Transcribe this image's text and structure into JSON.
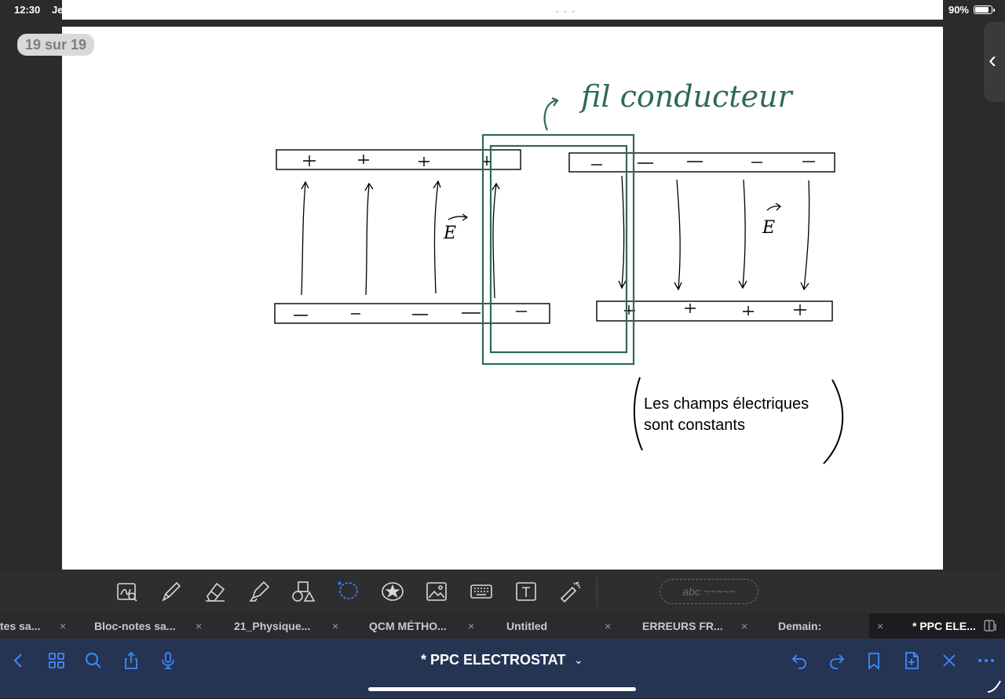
{
  "status_bar": {
    "time": "12:30",
    "date_fragment": "Je",
    "battery": "90%",
    "battery_level": 0.9
  },
  "page_counter": "19 sur 19",
  "canvas": {
    "annotation_fil": "fil conducteur",
    "field_label_left": "E",
    "field_label_right": "E",
    "note_line1": "Les champs électriques",
    "note_line2": "sont constants",
    "colors": {
      "ink": "#000000",
      "green_ink": "#2e6b4f"
    }
  },
  "toolbar": {
    "tools": [
      {
        "name": "zoom-pen-icon"
      },
      {
        "name": "pen-icon"
      },
      {
        "name": "eraser-icon"
      },
      {
        "name": "highlighter-icon"
      },
      {
        "name": "shapes-icon"
      },
      {
        "name": "lasso-icon",
        "active": true
      },
      {
        "name": "sticker-icon"
      },
      {
        "name": "image-icon"
      },
      {
        "name": "keyboard-icon"
      },
      {
        "name": "text-box-icon"
      },
      {
        "name": "laser-pointer-icon"
      }
    ],
    "handwriting_placeholder": "abc ~~~~~"
  },
  "tabs": [
    {
      "label": "tes sa...",
      "close": "×"
    },
    {
      "label": "Bloc-notes sa...",
      "close": "×"
    },
    {
      "label": "21_Physique...",
      "close": "×"
    },
    {
      "label": "QCM MÉTHO...",
      "close": "×"
    },
    {
      "label": "Untitled",
      "close": "×"
    },
    {
      "label": "ERREURS FR...",
      "close": "×"
    },
    {
      "label": "Demain:",
      "close": "×"
    },
    {
      "label": "* PPC ELE...",
      "active": true
    }
  ],
  "navbar": {
    "title": "* PPC ELECTROSTAT",
    "chevron": "⌄",
    "accent_color": "#3d8bff"
  }
}
